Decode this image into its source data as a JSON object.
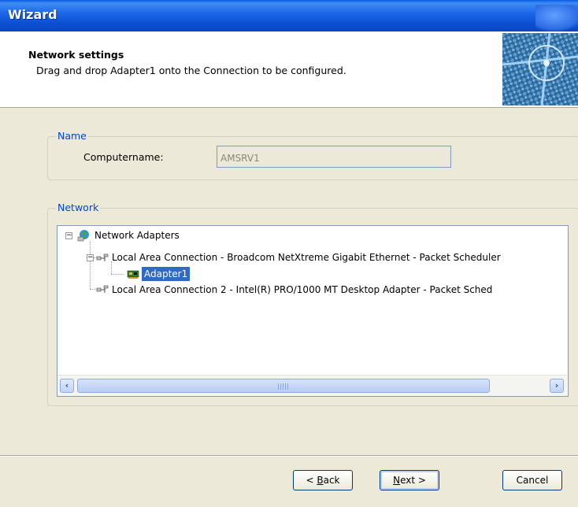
{
  "window": {
    "title": "Wizard"
  },
  "header": {
    "title": "Network settings",
    "description": "Drag and drop Adapter1 onto the Connection to be configured."
  },
  "name_group": {
    "legend": "Name",
    "computername_label": "Computername:",
    "computername_value": "AMSRV1"
  },
  "network_group": {
    "legend": "Network",
    "tree": {
      "root": "Network Adapters",
      "connection1": "Local Area Connection - Broadcom NetXtreme Gigabit Ethernet - Packet Scheduler",
      "adapter": "Adapter1",
      "connection2": "Local Area Connection 2 - Intel(R) PRO/1000 MT Desktop Adapter - Packet Sched"
    },
    "scrollbar": {
      "left_arrow": "‹",
      "right_arrow": "›"
    }
  },
  "buttons": {
    "back_prefix": "< ",
    "back_mnemonic": "B",
    "back_rest": "ack",
    "next_mnemonic": "N",
    "next_rest": "ext >",
    "cancel": "Cancel"
  },
  "colors": {
    "titlebar": "#0b4fd1",
    "legend": "#0046d5",
    "selection": "#316ac5"
  }
}
